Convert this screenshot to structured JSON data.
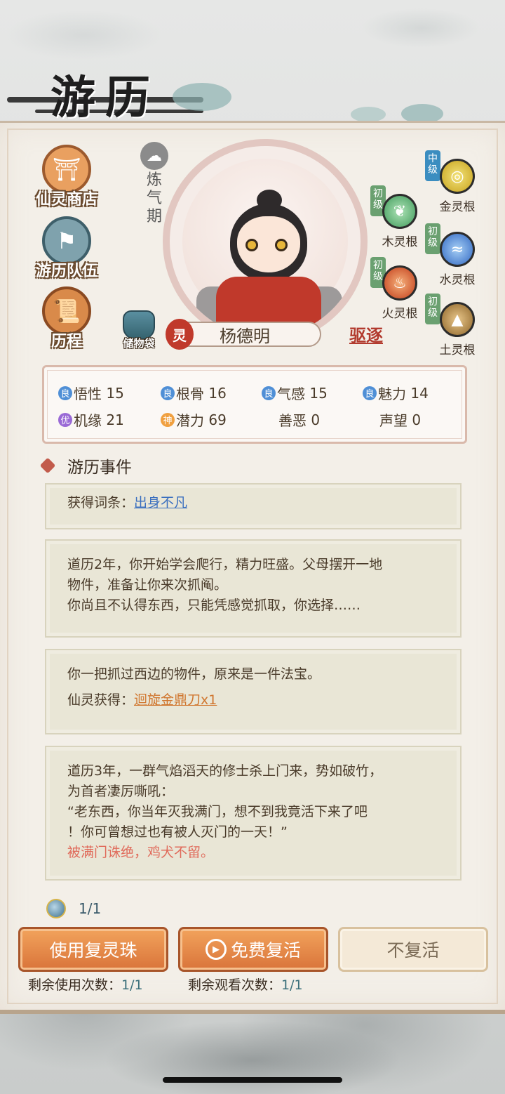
{
  "title": "游历",
  "menu": [
    {
      "label": "仙灵商店",
      "icon": "shop-icon"
    },
    {
      "label": "游历队伍",
      "icon": "team-flag-icon"
    },
    {
      "label": "历程",
      "icon": "scroll-icon"
    }
  ],
  "character": {
    "realm": "炼气期",
    "spirit_badge": "灵",
    "name": "杨德明",
    "bag_label": "储物袋",
    "expel_label": "驱逐"
  },
  "spirit_roots": [
    {
      "grade": "中级",
      "name": "金灵根",
      "color": "#d9c23a",
      "tag_color": "#3b8dc0"
    },
    {
      "grade": "初级",
      "name": "木灵根",
      "color": "#5fb67a",
      "tag_color": "#6aa070"
    },
    {
      "grade": "初级",
      "name": "水灵根",
      "color": "#3b7fd1",
      "tag_color": "#6aa070"
    },
    {
      "grade": "初级",
      "name": "火灵根",
      "color": "#d4562a",
      "tag_color": "#6aa070"
    },
    {
      "grade": "初级",
      "name": "土灵根",
      "color": "#a0793a",
      "tag_color": "#6aa070"
    }
  ],
  "stats": [
    {
      "grade": "良",
      "grade_color": "#4f8fd6",
      "label": "悟性",
      "value": "15"
    },
    {
      "grade": "良",
      "grade_color": "#4f8fd6",
      "label": "根骨",
      "value": "16"
    },
    {
      "grade": "良",
      "grade_color": "#4f8fd6",
      "label": "气感",
      "value": "15"
    },
    {
      "grade": "良",
      "grade_color": "#4f8fd6",
      "label": "魅力",
      "value": "14"
    },
    {
      "grade": "优",
      "grade_color": "#9a6ad6",
      "label": "机缘",
      "value": "21"
    },
    {
      "grade": "神",
      "grade_color": "#f0a040",
      "label": "潜力",
      "value": "69"
    },
    {
      "grade": "",
      "grade_color": "",
      "label": "善恶",
      "value": "0"
    },
    {
      "grade": "",
      "grade_color": "",
      "label": "声望",
      "value": "0"
    }
  ],
  "events_header": "游历事件",
  "events": {
    "e1_prefix": "获得词条：",
    "e1_link": "出身不凡",
    "e2_line1": "道历2年，你开始学会爬行，精力旺盛。父母摆开一地",
    "e2_line2": "物件，准备让你来次抓阄。",
    "e2_line3": "你尚且不认得东西，只能凭感觉抓取，你选择……",
    "e3_line1": "你一把抓过西边的物件，原来是一件法宝。",
    "e3_prefix": "仙灵获得：",
    "e3_link": "迴旋金鼎刀x1",
    "e4_line1": "道历3年，一群气焰滔天的修士杀上门来，势如破竹，",
    "e4_line2": "为首者凄厉嘶吼：",
    "e4_line3": "“老东西，你当年灭我满门，想不到我竟活下来了吧",
    "e4_line4": "！你可曾想过也有被人灭门的一天！”",
    "e4_red": "被满门诛绝，鸡犬不留。"
  },
  "pearl_count": "1/1",
  "buttons": {
    "use_pearl": "使用复灵珠",
    "free_revive": "免费复活",
    "no_revive": "不复活"
  },
  "remain": {
    "use_label": "剩余使用次数：",
    "use_value": "1/1",
    "watch_label": "剩余观看次数：",
    "watch_value": "1/1"
  }
}
